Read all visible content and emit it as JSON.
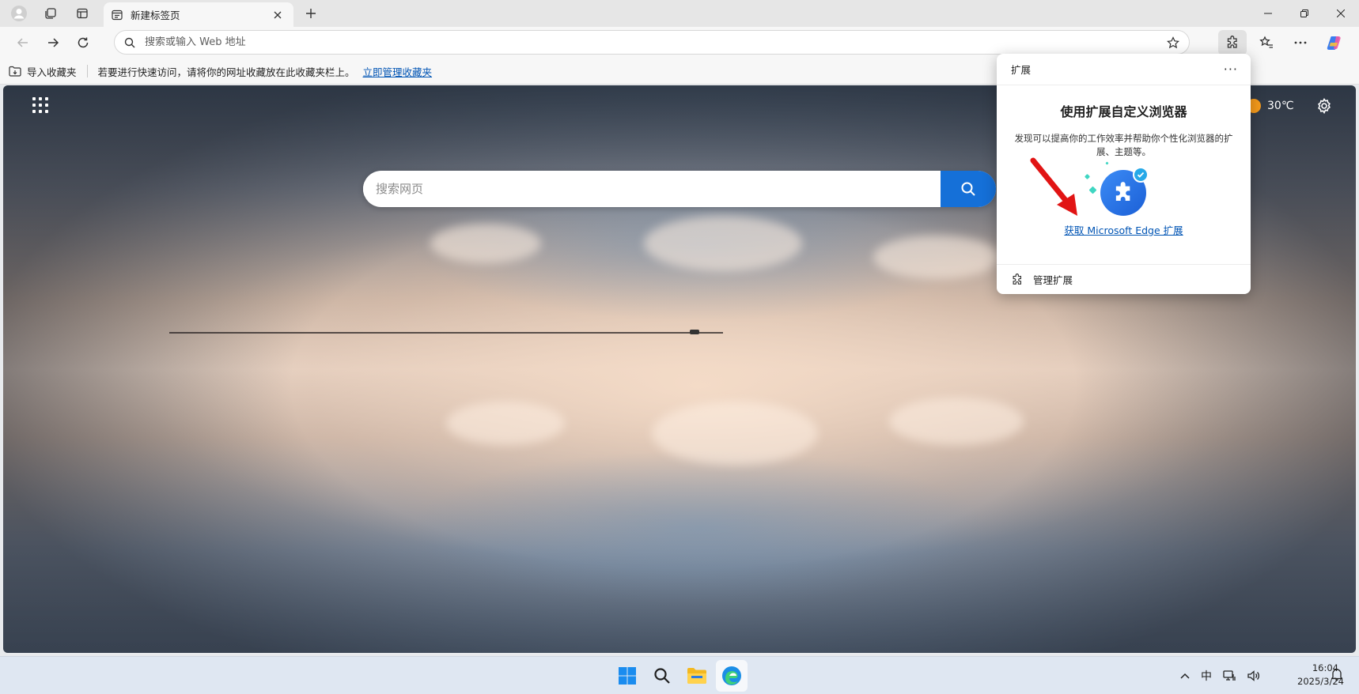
{
  "tab": {
    "title": "新建标签页"
  },
  "toolbar": {
    "address_placeholder": "搜索或输入 Web 地址"
  },
  "favorites": {
    "import_label": "导入收藏夹",
    "hint": "若要进行快速访问，请将你的网址收藏放在此收藏夹栏上。",
    "manage_link": "立即管理收藏夹"
  },
  "ntp": {
    "search_placeholder": "搜索网页",
    "weather_temp": "30℃"
  },
  "extensions_popup": {
    "title": "扩展",
    "more": "···",
    "heading": "使用扩展自定义浏览器",
    "description": "发现可以提高你的工作效率并帮助你个性化浏览器的扩展、主题等。",
    "get_link": "获取 Microsoft Edge 扩展",
    "manage_label": "管理扩展"
  },
  "taskbar": {
    "ime": "中",
    "time": "16:04",
    "date": "2025/3/24"
  },
  "colors": {
    "accent": "#1570d8",
    "link": "#0054b4",
    "annotation_arrow": "#e11414"
  }
}
